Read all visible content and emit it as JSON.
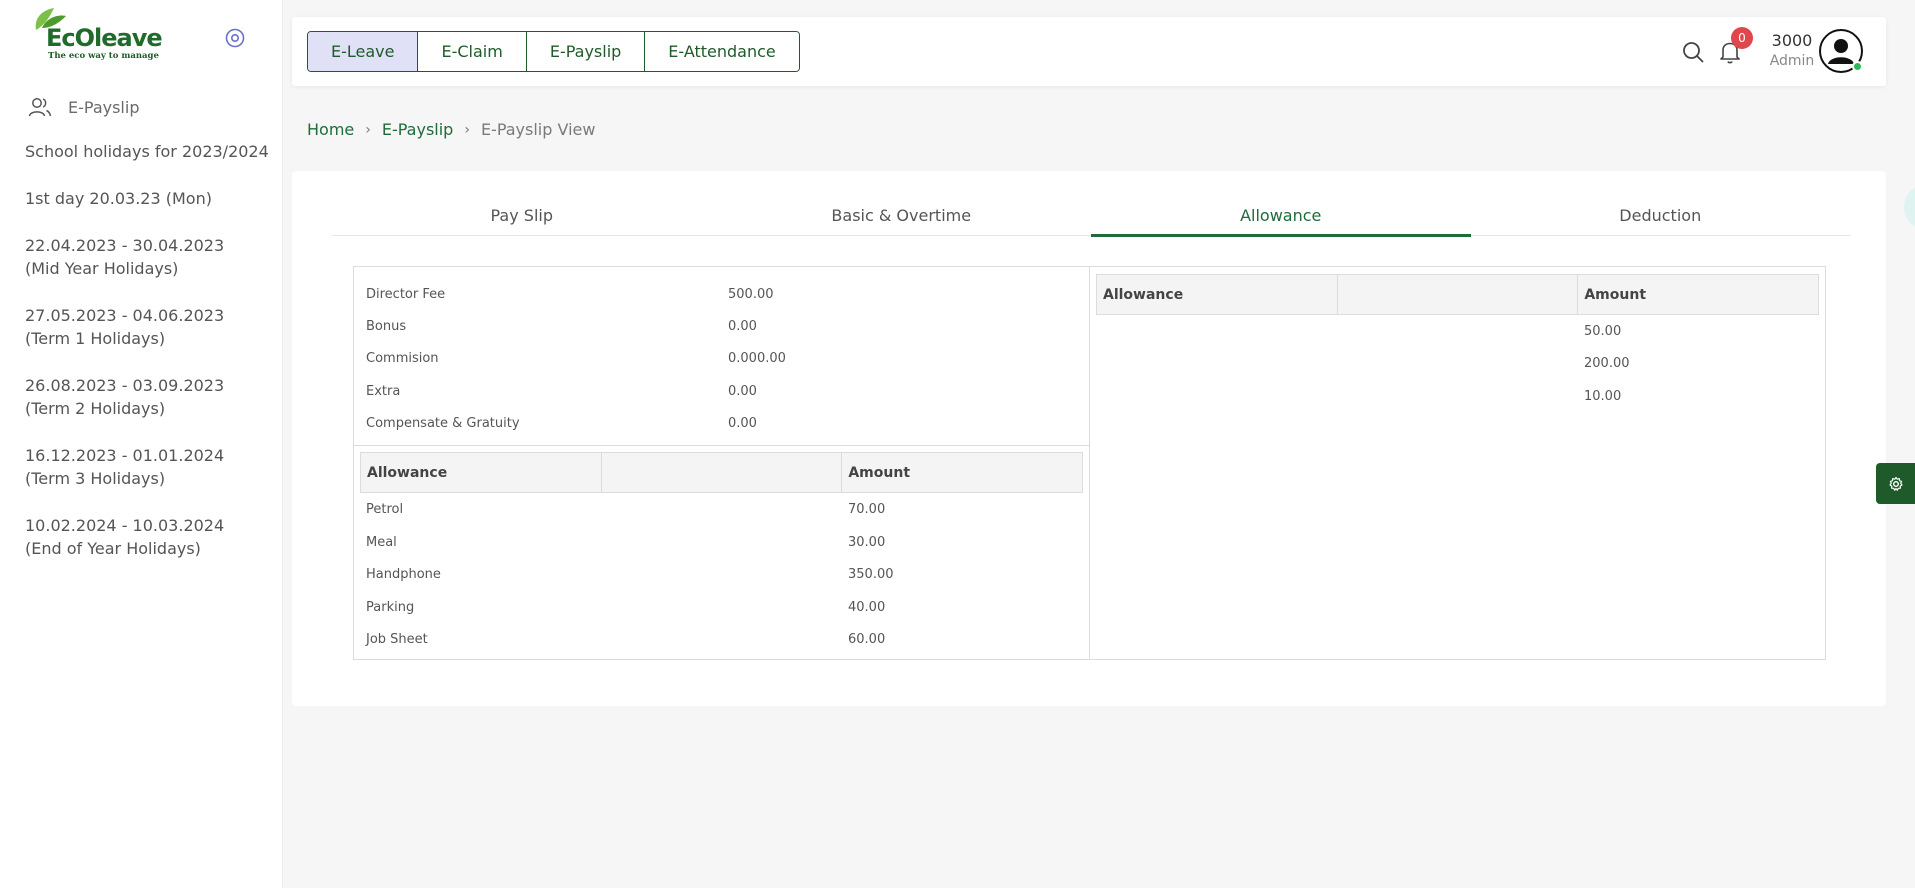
{
  "logo": {
    "text": "EcOleave",
    "tagline": "The eco way to manage"
  },
  "sidebar": {
    "nav_item": "E-Payslip",
    "holidays": [
      "School holidays for 2023/2024",
      "1st day 20.03.23 (Mon)",
      "22.04.2023 - 30.04.2023\n(Mid Year Holidays)",
      "27.05.2023 - 04.06.2023\n(Term 1 Holidays)",
      "26.08.2023 - 03.09.2023\n(Term 2 Holidays)",
      "16.12.2023 - 01.01.2024\n(Term 3 Holidays)",
      "10.02.2024 - 10.03.2024\n(End of Year Holidays)"
    ]
  },
  "topbar": {
    "modules": [
      "E-Leave",
      "E-Claim",
      "E-Payslip",
      "E-Attendance"
    ],
    "active_module": "E-Leave",
    "notification_count": "0",
    "user_name": "3000",
    "user_role": "Admin"
  },
  "breadcrumb": {
    "home": "Home",
    "section": "E-Payslip",
    "current": "E-Payslip View"
  },
  "tabs": [
    "Pay Slip",
    "Basic & Overtime",
    "Allowance",
    "Deduction"
  ],
  "active_tab": "Allowance",
  "fees": [
    {
      "label": "Director Fee",
      "value": "500.00"
    },
    {
      "label": "Bonus",
      "value": "0.00"
    },
    {
      "label": "Commision",
      "value": "0.000.00"
    },
    {
      "label": "Extra",
      "value": "0.00"
    },
    {
      "label": "Compensate & Gratuity",
      "value": "0.00"
    }
  ],
  "left_allowance": {
    "headers": [
      "Allowance",
      "",
      "Amount"
    ],
    "rows": [
      {
        "name": "Petrol",
        "amount": "70.00"
      },
      {
        "name": "Meal",
        "amount": "30.00"
      },
      {
        "name": "Handphone",
        "amount": "350.00"
      },
      {
        "name": "Parking",
        "amount": "40.00"
      },
      {
        "name": "Job Sheet",
        "amount": "60.00"
      }
    ]
  },
  "right_allowance": {
    "headers": [
      "Allowance",
      "",
      "Amount"
    ],
    "rows": [
      {
        "name": "",
        "amount": "50.00"
      },
      {
        "name": "",
        "amount": "200.00"
      },
      {
        "name": "",
        "amount": "10.00"
      }
    ]
  },
  "colors": {
    "brand_green": "#1f5b2a",
    "active_module_bg": "#e0e1f7",
    "badge_red": "#e0474c",
    "online_green": "#2eb85c"
  }
}
